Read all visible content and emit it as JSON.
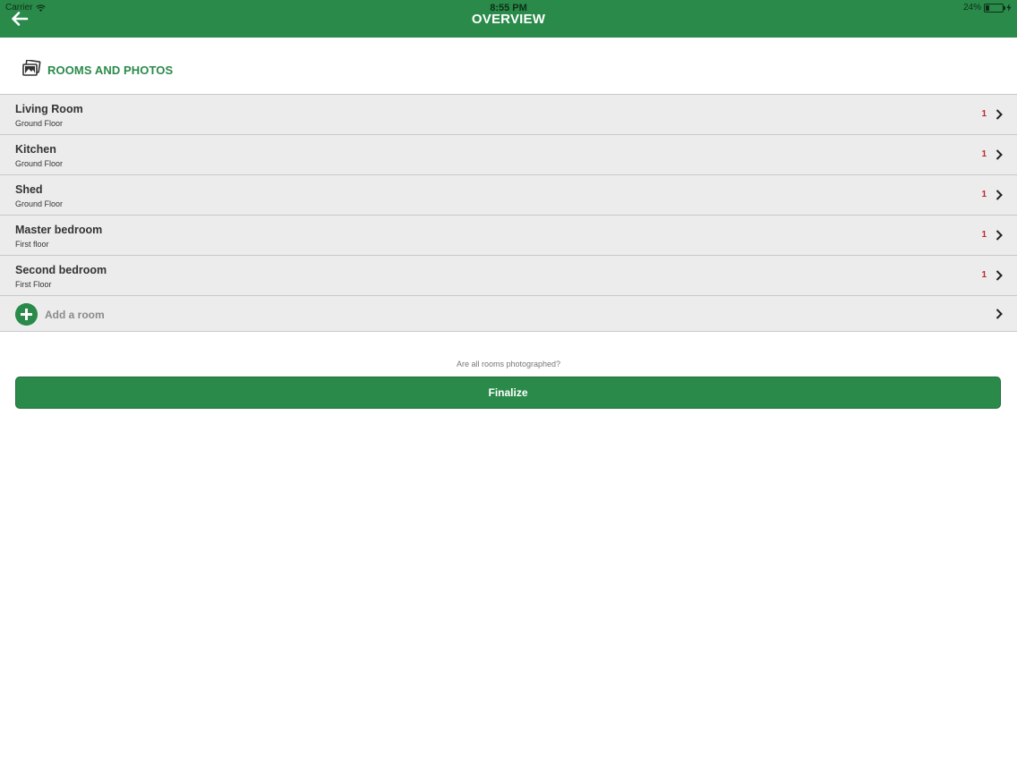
{
  "status": {
    "carrier": "Carrier",
    "time": "8:55 PM",
    "battery": "24%"
  },
  "nav": {
    "title": "OVERVIEW"
  },
  "section": {
    "title": "ROOMS AND PHOTOS"
  },
  "rooms": [
    {
      "name": "Living Room",
      "floor": "Ground Floor",
      "count": "1"
    },
    {
      "name": "Kitchen",
      "floor": "Ground Floor",
      "count": "1"
    },
    {
      "name": "Shed",
      "floor": "Ground Floor",
      "count": "1"
    },
    {
      "name": "Master bedroom",
      "floor": "First floor",
      "count": "1"
    },
    {
      "name": "Second bedroom",
      "floor": "First Floor",
      "count": "1"
    }
  ],
  "add_room": {
    "label": "Add a room"
  },
  "question": "Are all rooms photographed?",
  "finalize": {
    "label": "Finalize"
  },
  "colors": {
    "primary": "#2a8a4a",
    "count": "#c0272d",
    "row_bg": "#ececec"
  },
  "battery_level": 0.24
}
